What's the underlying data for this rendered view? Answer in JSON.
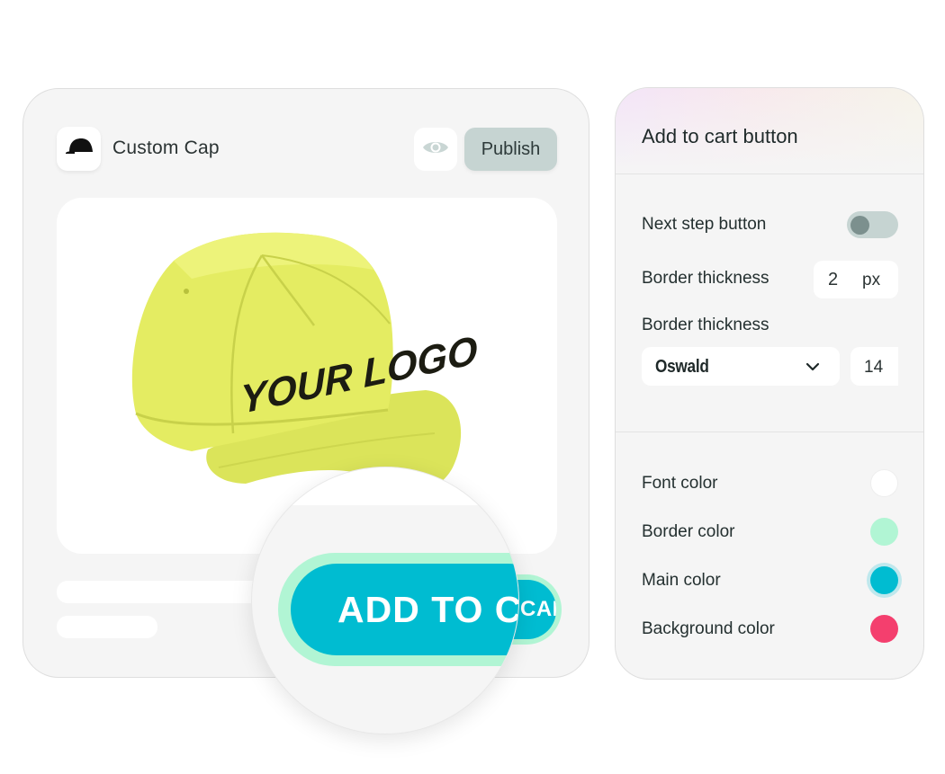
{
  "product": {
    "title": "Custom Cap",
    "logo_icon": "cap-icon",
    "preview_icon": "eye-icon",
    "publish_label": "Publish",
    "image_text": "YOUR LOGO",
    "cart_button_label": "ADD TO CART",
    "cart_button_small_label": "CART"
  },
  "settings": {
    "title": "Add to cart button",
    "next_step_label": "Next step button",
    "next_step_enabled": false,
    "border_thickness_label": "Border thickness",
    "border_thickness_value": "2",
    "border_thickness_unit": "px",
    "font_section_label": "Border thickness",
    "font_family_value": "Oswald",
    "font_size_value": "14",
    "colors": [
      {
        "label": "Font color",
        "color": "#ffffff"
      },
      {
        "label": "Border color",
        "color": "#b1f5d4"
      },
      {
        "label": "Main color",
        "color": "#00bcd1"
      },
      {
        "label": "Background color",
        "color": "#f43f6e"
      }
    ]
  },
  "theme": {
    "accent": "#00bcd1",
    "accent_border": "#b1f5d4",
    "cap_color": "#e4ec62",
    "publish_bg": "#c6d4d2"
  }
}
